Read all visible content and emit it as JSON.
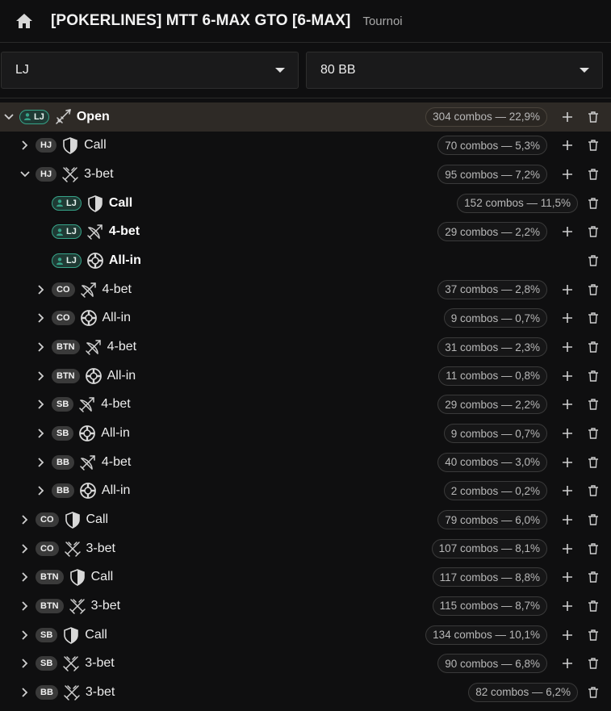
{
  "header": {
    "title": "[POKERLINES] MTT 6-MAX GTO [6-MAX]",
    "subtitle": "Tournoi"
  },
  "selects": {
    "position": "LJ",
    "stack": "80 BB"
  },
  "rows": [
    {
      "level": 0,
      "chev": "down",
      "pos": "LJ",
      "hero": true,
      "icon": "open",
      "label": "Open",
      "bold": true,
      "combos": "304 combos — 22,9%",
      "plus": true,
      "active": true
    },
    {
      "level": 1,
      "chev": "right",
      "pos": "HJ",
      "hero": false,
      "icon": "call",
      "label": "Call",
      "bold": false,
      "combos": "70 combos — 5,3%",
      "plus": true
    },
    {
      "level": 1,
      "chev": "down",
      "pos": "HJ",
      "hero": false,
      "icon": "3bet",
      "label": "3-bet",
      "bold": false,
      "combos": "95 combos — 7,2%",
      "plus": true
    },
    {
      "level": 2,
      "chev": "none",
      "pos": "LJ",
      "hero": true,
      "icon": "call",
      "label": "Call",
      "bold": true,
      "combos": "152 combos — 11,5%",
      "plus": false
    },
    {
      "level": 2,
      "chev": "none",
      "pos": "LJ",
      "hero": true,
      "icon": "4bet",
      "label": "4-bet",
      "bold": true,
      "combos": "29 combos — 2,2%",
      "plus": true
    },
    {
      "level": 2,
      "chev": "none",
      "pos": "LJ",
      "hero": true,
      "icon": "allin",
      "label": "All-in",
      "bold": true,
      "combos": "",
      "plus": false
    },
    {
      "level": 2,
      "chev": "right",
      "pos": "CO",
      "hero": false,
      "icon": "4bet",
      "label": "4-bet",
      "bold": false,
      "combos": "37 combos — 2,8%",
      "plus": true
    },
    {
      "level": 2,
      "chev": "right",
      "pos": "CO",
      "hero": false,
      "icon": "allin",
      "label": "All-in",
      "bold": false,
      "combos": "9 combos — 0,7%",
      "plus": true
    },
    {
      "level": 2,
      "chev": "right",
      "pos": "BTN",
      "hero": false,
      "icon": "4bet",
      "label": "4-bet",
      "bold": false,
      "combos": "31 combos — 2,3%",
      "plus": true
    },
    {
      "level": 2,
      "chev": "right",
      "pos": "BTN",
      "hero": false,
      "icon": "allin",
      "label": "All-in",
      "bold": false,
      "combos": "11 combos — 0,8%",
      "plus": true
    },
    {
      "level": 2,
      "chev": "right",
      "pos": "SB",
      "hero": false,
      "icon": "4bet",
      "label": "4-bet",
      "bold": false,
      "combos": "29 combos — 2,2%",
      "plus": true
    },
    {
      "level": 2,
      "chev": "right",
      "pos": "SB",
      "hero": false,
      "icon": "allin",
      "label": "All-in",
      "bold": false,
      "combos": "9 combos — 0,7%",
      "plus": true
    },
    {
      "level": 2,
      "chev": "right",
      "pos": "BB",
      "hero": false,
      "icon": "4bet",
      "label": "4-bet",
      "bold": false,
      "combos": "40 combos — 3,0%",
      "plus": true
    },
    {
      "level": 2,
      "chev": "right",
      "pos": "BB",
      "hero": false,
      "icon": "allin",
      "label": "All-in",
      "bold": false,
      "combos": "2 combos — 0,2%",
      "plus": true
    },
    {
      "level": 1,
      "chev": "right",
      "pos": "CO",
      "hero": false,
      "icon": "call",
      "label": "Call",
      "bold": false,
      "combos": "79 combos — 6,0%",
      "plus": true
    },
    {
      "level": 1,
      "chev": "right",
      "pos": "CO",
      "hero": false,
      "icon": "3bet",
      "label": "3-bet",
      "bold": false,
      "combos": "107 combos — 8,1%",
      "plus": true
    },
    {
      "level": 1,
      "chev": "right",
      "pos": "BTN",
      "hero": false,
      "icon": "call",
      "label": "Call",
      "bold": false,
      "combos": "117 combos — 8,8%",
      "plus": true
    },
    {
      "level": 1,
      "chev": "right",
      "pos": "BTN",
      "hero": false,
      "icon": "3bet",
      "label": "3-bet",
      "bold": false,
      "combos": "115 combos — 8,7%",
      "plus": true
    },
    {
      "level": 1,
      "chev": "right",
      "pos": "SB",
      "hero": false,
      "icon": "call",
      "label": "Call",
      "bold": false,
      "combos": "134 combos — 10,1%",
      "plus": true
    },
    {
      "level": 1,
      "chev": "right",
      "pos": "SB",
      "hero": false,
      "icon": "3bet",
      "label": "3-bet",
      "bold": false,
      "combos": "90 combos — 6,8%",
      "plus": true
    },
    {
      "level": 1,
      "chev": "right",
      "pos": "BB",
      "hero": false,
      "icon": "3bet",
      "label": "3-bet",
      "bold": false,
      "combos": "82 combos — 6,2%",
      "plus": false
    }
  ]
}
